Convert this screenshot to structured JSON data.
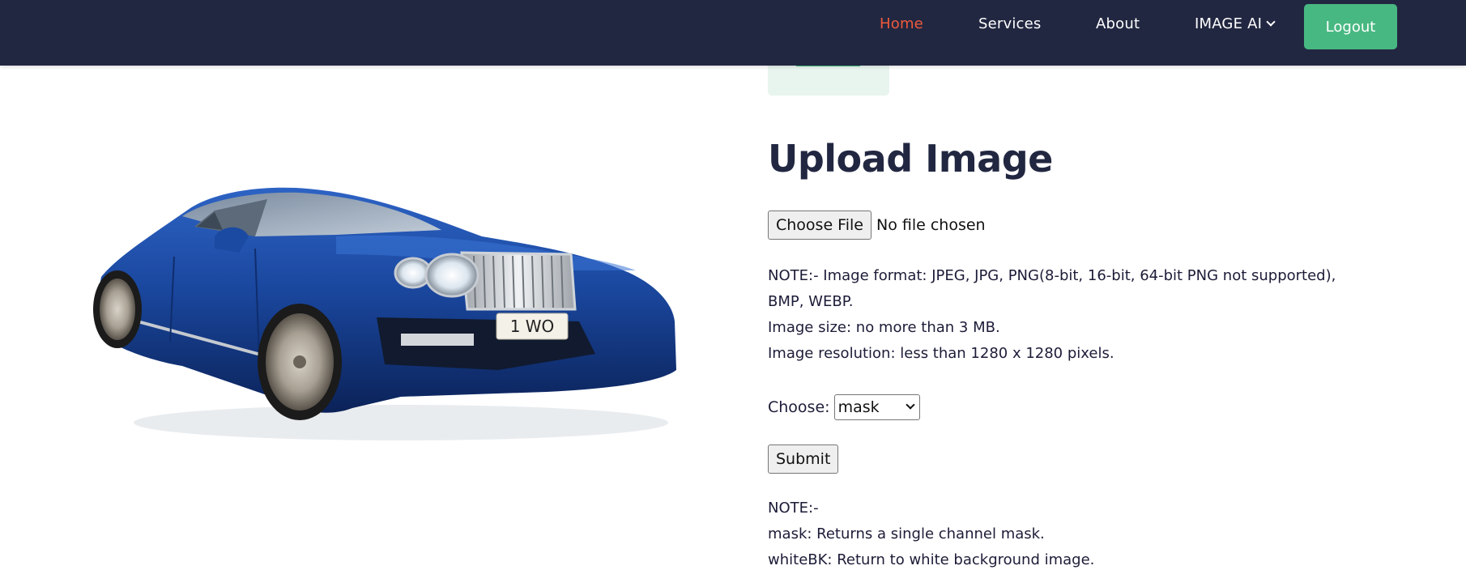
{
  "nav": {
    "links": [
      {
        "label": "Home",
        "active": true
      },
      {
        "label": "Services",
        "active": false
      },
      {
        "label": "About",
        "active": false
      },
      {
        "label": "IMAGE AI",
        "active": false,
        "has_dropdown": true
      }
    ],
    "logout_label": "Logout"
  },
  "colors": {
    "nav_bg": "#222741",
    "nav_active": "#ef5a3b",
    "accent_green": "#47b881",
    "title_color": "#222741"
  },
  "hero": {
    "image_subject": "blue luxury sedan",
    "plate_text": "1 WO"
  },
  "upload": {
    "title": "Upload Image",
    "choose_file_label": "Choose File",
    "file_status": "No file chosen",
    "notes": [
      "NOTE:- Image format: JPEG, JPG, PNG(8-bit, 16-bit, 64-bit PNG not supported),",
      "BMP, WEBP.",
      "Image size: no more than 3 MB.",
      "Image resolution: less than 1280 x 1280 pixels."
    ],
    "choose_label": "Choose:",
    "selected_option": "mask",
    "submit_label": "Submit",
    "option_notes": [
      "NOTE:-",
      "mask: Returns a single channel mask.",
      "whiteBK: Return to white background image."
    ]
  }
}
